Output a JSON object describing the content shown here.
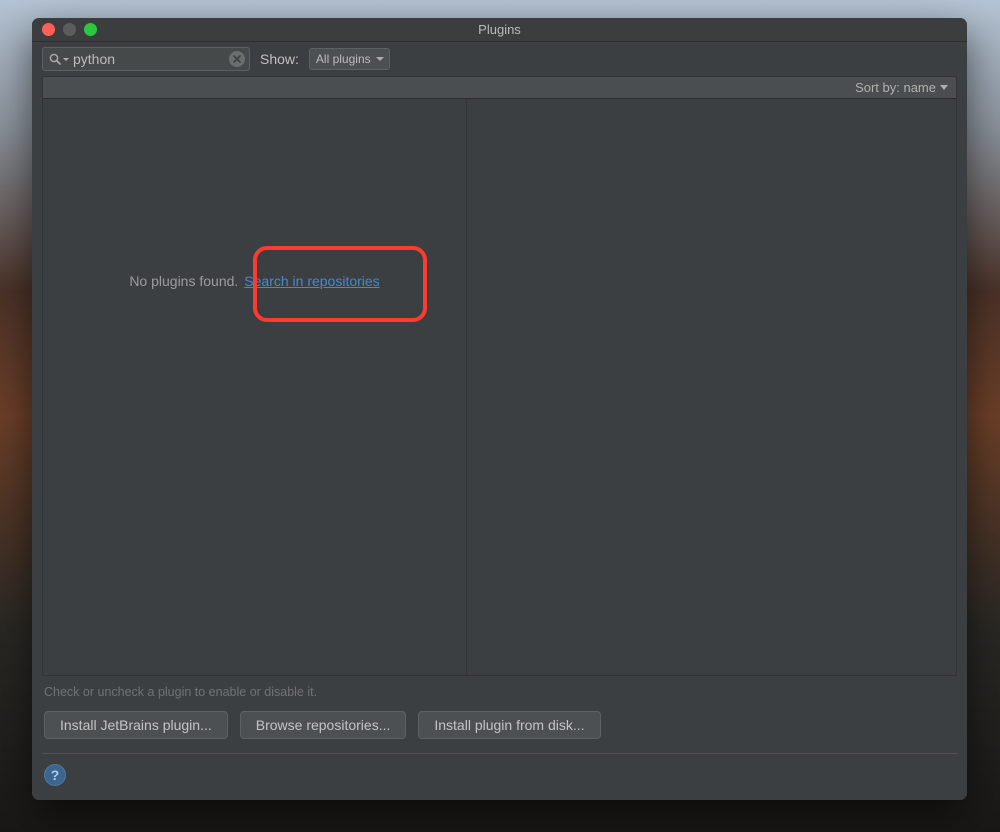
{
  "window": {
    "title": "Plugins"
  },
  "toolbar": {
    "search_value": "python",
    "search_placeholder": "",
    "show_label": "Show:",
    "show_selected": "All plugins"
  },
  "sort": {
    "label": "Sort by: name"
  },
  "empty": {
    "message": "No plugins found.",
    "link": "Search in repositories"
  },
  "hint": "Check or uncheck a plugin to enable or disable it.",
  "buttons": {
    "install_jetbrains": "Install JetBrains plugin...",
    "browse": "Browse repositories...",
    "install_disk": "Install plugin from disk..."
  },
  "footer": {
    "help": "?"
  }
}
